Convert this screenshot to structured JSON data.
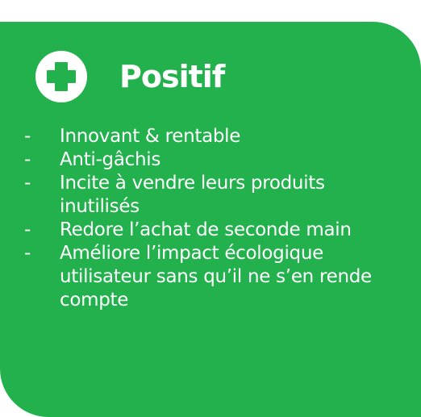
{
  "card": {
    "title": "Positif",
    "accent_color": "#22b14c",
    "icon": "plus-icon",
    "bullet": "-",
    "items": [
      {
        "text": "Innovant & rentable"
      },
      {
        "text": "Anti-gâchis"
      },
      {
        "text": "Incite à vendre leurs produits inutilisés"
      },
      {
        "text": "Redore l’achat de seconde main"
      },
      {
        "text": "Améliore l’impact écologique utilisateur sans qu’il ne s’en rende compte"
      }
    ]
  }
}
